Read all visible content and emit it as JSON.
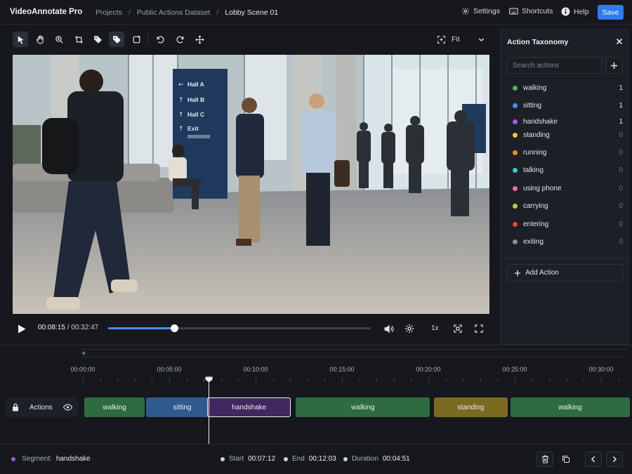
{
  "app": {
    "title": "VideoAnnotate Pro"
  },
  "breadcrumbs": [
    "Projects",
    "Public Actions Dataset",
    "Lobby Scene 01"
  ],
  "header": {
    "settings_label": "Settings",
    "shortcuts_label": "Shortcuts",
    "help_label": "Help",
    "save_label": "Save",
    "accent_color": "#2f7bf0"
  },
  "toolbar": {
    "tools": [
      "select-icon",
      "hand-icon",
      "zoom-icon",
      "crop-icon",
      "tag-icon",
      "tag-filled-icon",
      "rotate-icon",
      "undo-icon",
      "redo-icon",
      "move-icon"
    ],
    "zoom_label": "Fit"
  },
  "video": {
    "scene": "office lobby with people walking, sitting and shaking hands",
    "sign": {
      "items": [
        "Hall A",
        "Hall B",
        "Hall C",
        "Exit"
      ]
    }
  },
  "player": {
    "current_time": "00:08:15",
    "separator": " / ",
    "total_time": "00:32:47",
    "progress": 0.2517,
    "speed": "1x"
  },
  "panel": {
    "title": "Action Taxonomy",
    "search_placeholder": "Search actions",
    "add_action_label": "Add Action",
    "actions": [
      {
        "label": "walking",
        "count": "1",
        "color": "#3fbf5a"
      },
      {
        "label": "sitting",
        "count": "1",
        "color": "#4a8ef5"
      },
      {
        "label": "handshake",
        "count": "1",
        "color": "#a35be8"
      },
      {
        "label": "standing",
        "count": "0",
        "color": "#e6c93a"
      },
      {
        "label": "running",
        "count": "0",
        "color": "#f08a2a"
      },
      {
        "label": "talking",
        "count": "0",
        "color": "#3cc6d8"
      },
      {
        "label": "using phone",
        "count": "0",
        "color": "#e86bb0"
      },
      {
        "label": "carrying",
        "count": "0",
        "color": "#b5d62e"
      },
      {
        "label": "entering",
        "count": "0",
        "color": "#e8453f"
      },
      {
        "label": "exiting",
        "count": "0",
        "color": "#8a9099"
      }
    ]
  },
  "timeline": {
    "ruler": [
      "00:00:00",
      "00:05:00",
      "00:10:00",
      "00:15:00",
      "00:20:00",
      "00:25:00",
      "00:30:00"
    ],
    "track_label": "Actions",
    "playhead_time": "00:08:15",
    "segments": [
      {
        "label": "walking",
        "color": "#2f6b40",
        "start": "00:00:00",
        "end": "00:03:35"
      },
      {
        "label": "sitting",
        "color": "#2f5a8e",
        "start": "00:03:40",
        "end": "00:07:50"
      },
      {
        "label": "handshake",
        "color": "#40295e",
        "start": "00:07:12",
        "end": "00:12:03",
        "selected": true
      },
      {
        "label": "walking",
        "color": "#2f6b40",
        "start": "00:12:20",
        "end": "00:20:05"
      },
      {
        "label": "standing",
        "color": "#7a6a22",
        "start": "00:20:20",
        "end": "00:24:35"
      },
      {
        "label": "walking",
        "color": "#2f6b40",
        "start": "00:24:45",
        "end": "00:31:30"
      }
    ]
  },
  "footer": {
    "segment_label": "Segment:",
    "segment_value": "handshake",
    "segment_color": "#a35be8",
    "start_label": "Start",
    "start_value": "00:07:12",
    "end_label": "End",
    "end_value": "00:12:03",
    "duration_label": "Duration",
    "duration_value": "00:04:51"
  }
}
